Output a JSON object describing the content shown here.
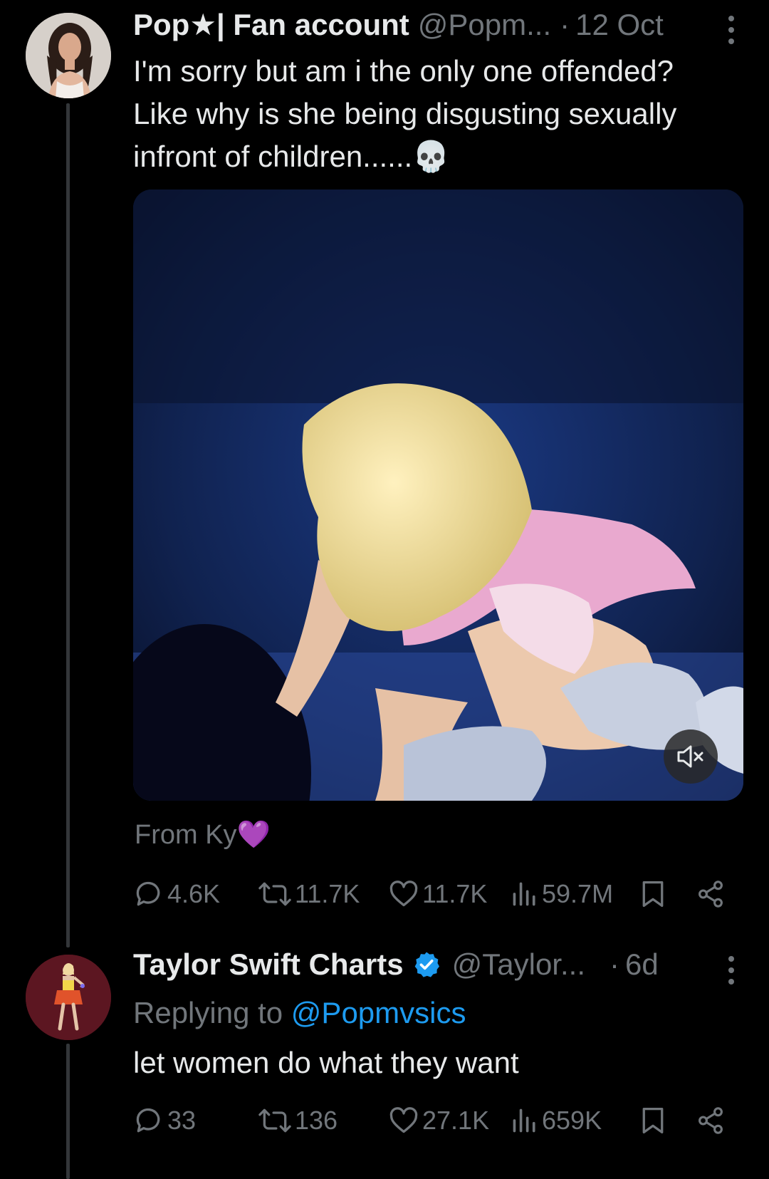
{
  "tweets": [
    {
      "author_name": "Pop★| Fan account",
      "handle": "@Popm...",
      "separator": "·",
      "time": "12 Oct",
      "text_lines": [
        "I'm sorry but am i the only one offended?",
        "Like why is she being disgusting sexually",
        "infront of children......💀"
      ],
      "source": "From Ky💜",
      "stats": {
        "replies": "4.6K",
        "reposts": "11.7K",
        "likes": "11.7K",
        "views": "59.7M"
      },
      "avatar_icon": "profile-photo-avatar",
      "media_icon": "mute-icon"
    },
    {
      "author_name": "Taylor Swift Charts",
      "verified_icon": "verified-badge-icon",
      "handle": "@Taylor...",
      "separator": "·",
      "time": "6d",
      "replying_prefix": "Replying to ",
      "replying_to": "@Popmvsics",
      "text": "let women do what they want",
      "stats": {
        "replies": "33",
        "reposts": "136",
        "likes": "27.1K",
        "views": "659K"
      },
      "avatar_icon": "profile-photo-avatar"
    }
  ],
  "colors": {
    "background": "#000000",
    "primary_text": "#e7e9ea",
    "secondary_text": "#71767b",
    "link": "#1d9bf0",
    "verified": "#1d9bf0",
    "thread_line": "#333639"
  }
}
